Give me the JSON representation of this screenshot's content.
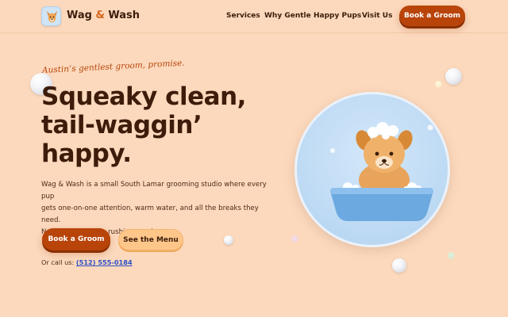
{
  "brand": {
    "name_part1": "Wag",
    "amp": "&",
    "name_part2": "Wash"
  },
  "nav": {
    "items": [
      {
        "label": "Services"
      },
      {
        "label": "Why Gentle"
      },
      {
        "label": "Happy Pups"
      },
      {
        "label": "Visit Us"
      }
    ],
    "cta_label": "Book a Groom"
  },
  "hero": {
    "tagline": "Austin’s gentlest groom, promise.",
    "headline_lines": [
      "Squeaky clean,",
      "tail-waggin’",
      "happy."
    ],
    "body_lines": [
      "Wag & Wash is a small South Lamar grooming studio where every pup",
      "gets one-on-one attention, warm water, and all the breaks they need.",
      "No cage dryers, no rushing, no drama."
    ],
    "primary_button": "Book a Groom",
    "secondary_button": "See the Menu",
    "call_prefix": "Or call us:",
    "phone": "(512) 555-0184"
  },
  "colors": {
    "background": "#fcd9bd",
    "accent": "#b8440a",
    "secondary_button": "#ffc68a",
    "link": "#2b4fc7",
    "illustration_circle": "#bcd9f3"
  },
  "icons": {
    "logo": "dog-face-icon",
    "illustration": "dog-in-bath-illustration"
  }
}
